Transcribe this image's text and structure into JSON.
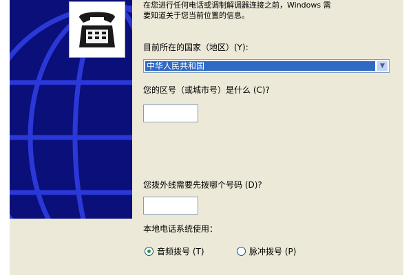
{
  "intro": {
    "line1": "在您进行任何电话或调制解调器连接之前，Windows 需",
    "line2": "要知道关于您当前位置的信息。"
  },
  "country": {
    "label": "目前所在的国家（地区）(Y):",
    "selected": "中华人民共和国"
  },
  "area_code": {
    "label": "您的区号（或城市号）是什么 (C)?",
    "value": ""
  },
  "outside_line": {
    "label": "您拨外线需要先拨哪个号码 (D)?",
    "value": ""
  },
  "dialing": {
    "label": "本地电话系统使用：",
    "options": [
      {
        "label": "音频拨号 (T)",
        "selected": true
      },
      {
        "label": "脉冲拨号 (P)",
        "selected": false
      }
    ]
  },
  "colors": {
    "banner": "#0a0f7a",
    "selection": "#316ac5",
    "dialog_bg": "#ece9d8"
  }
}
